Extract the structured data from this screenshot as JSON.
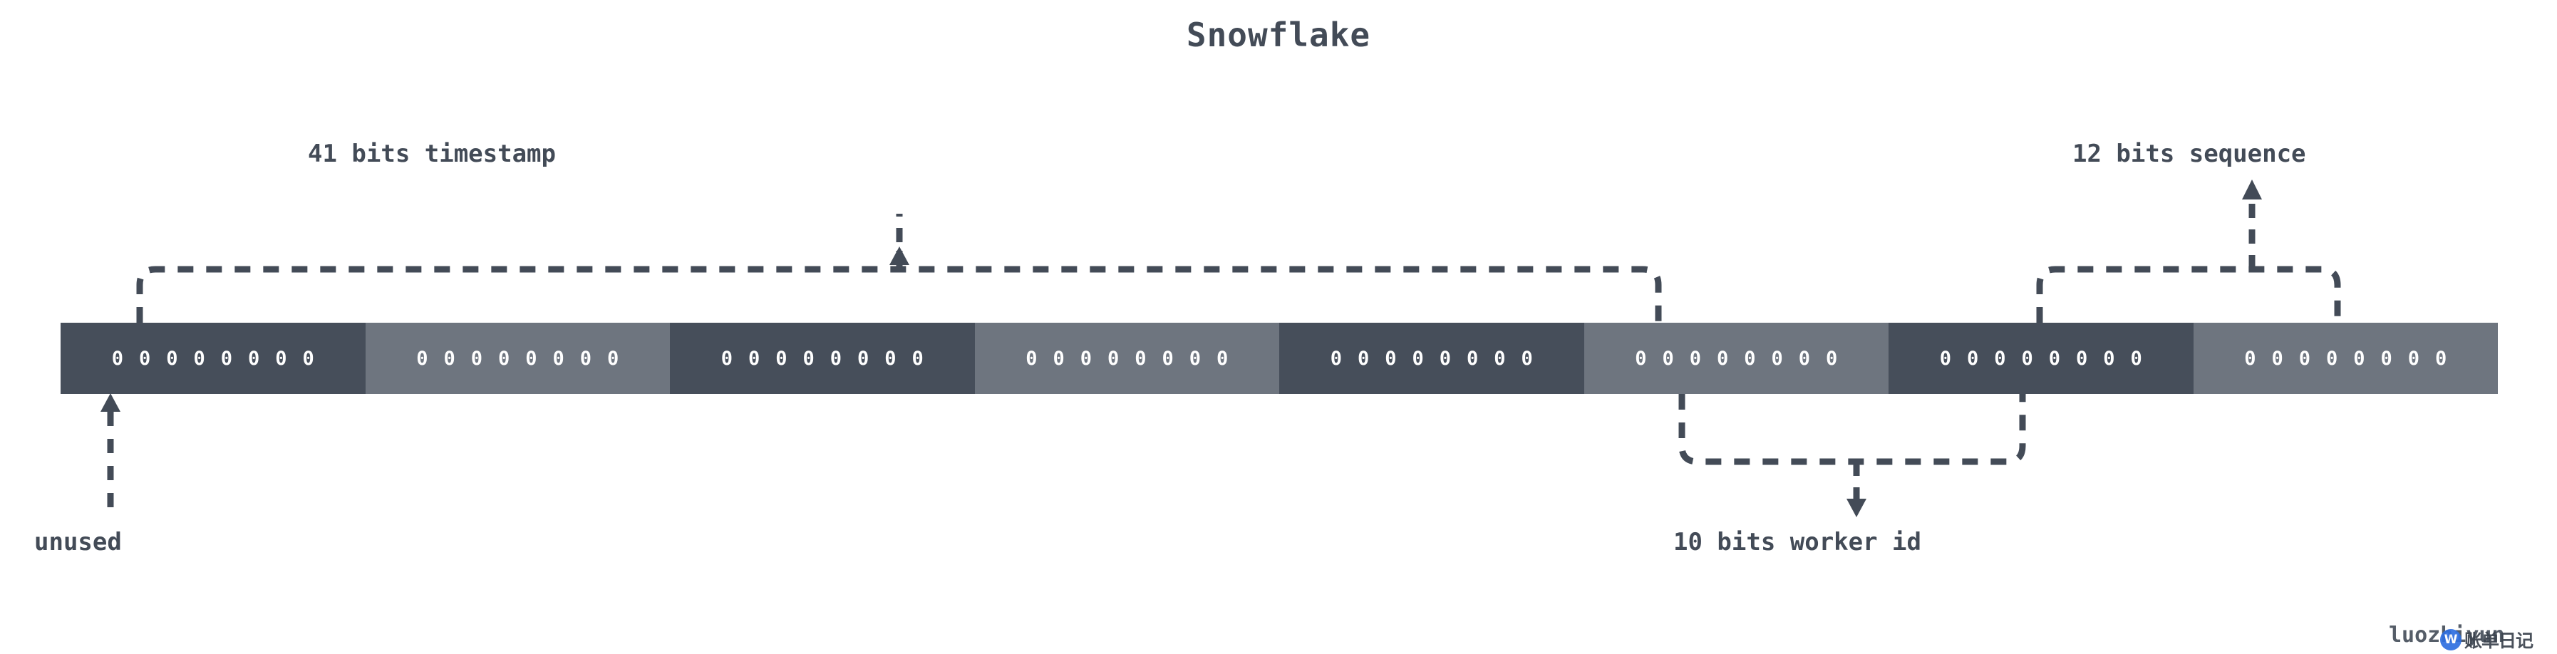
{
  "title": "Snowflake",
  "colors": {
    "ink": "#434b57",
    "byte_dark": "#464e5a",
    "byte_light": "#6e757f",
    "bit_text": "#ffffff",
    "background": "#ffffff",
    "brand_blue": "#2f6fe0"
  },
  "bitbar": {
    "byte_count": 8,
    "bits_per_byte": 8,
    "bytes": [
      {
        "index": 0,
        "shade": "dark",
        "bits": [
          "0",
          "0",
          "0",
          "0",
          "0",
          "0",
          "0",
          "0"
        ]
      },
      {
        "index": 1,
        "shade": "light",
        "bits": [
          "0",
          "0",
          "0",
          "0",
          "0",
          "0",
          "0",
          "0"
        ]
      },
      {
        "index": 2,
        "shade": "dark",
        "bits": [
          "0",
          "0",
          "0",
          "0",
          "0",
          "0",
          "0",
          "0"
        ]
      },
      {
        "index": 3,
        "shade": "light",
        "bits": [
          "0",
          "0",
          "0",
          "0",
          "0",
          "0",
          "0",
          "0"
        ]
      },
      {
        "index": 4,
        "shade": "dark",
        "bits": [
          "0",
          "0",
          "0",
          "0",
          "0",
          "0",
          "0",
          "0"
        ]
      },
      {
        "index": 5,
        "shade": "light",
        "bits": [
          "0",
          "0",
          "0",
          "0",
          "0",
          "0",
          "0",
          "0"
        ]
      },
      {
        "index": 6,
        "shade": "dark",
        "bits": [
          "0",
          "0",
          "0",
          "0",
          "0",
          "0",
          "0",
          "0"
        ]
      },
      {
        "index": 7,
        "shade": "light",
        "bits": [
          "0",
          "0",
          "0",
          "0",
          "0",
          "0",
          "0",
          "0"
        ]
      }
    ]
  },
  "callouts": {
    "unused": "unused",
    "timestamp": "41 bits timestamp",
    "worker_id": "10 bits worker id",
    "sequence": "12 bits sequence"
  },
  "watermark": {
    "text": "luozhiyun",
    "logo_glyph": "W",
    "brand_cn": "账单日记"
  }
}
